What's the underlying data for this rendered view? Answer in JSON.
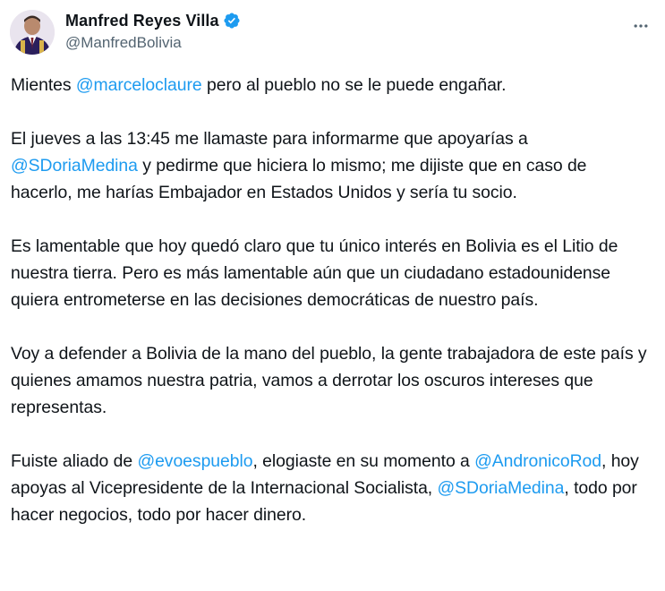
{
  "colors": {
    "accent": "#1d9bf0",
    "text": "#0f1419",
    "secondary": "#536471"
  },
  "author": {
    "display_name": "Manfred Reyes Villa",
    "handle": "@ManfredBolivia",
    "verified_icon": "verified-badge-icon",
    "avatar_icon": "profile-photo"
  },
  "menu": {
    "icon": "more-horizontal-icon"
  },
  "tweet": {
    "p1": {
      "t1": "Mientes ",
      "m1": "@marceloclaure",
      "t2": " pero al pueblo no se le puede engañar."
    },
    "p2": {
      "t1": "El jueves a las 13:45 me llamaste  para informarme que apoyarías a ",
      "m1": "@SDoriaMedina",
      "t2": " y pedirme que hiciera lo mismo; me dijiste que en caso de hacerlo, me harías Embajador en Estados Unidos y sería tu socio."
    },
    "p3": {
      "t1": "Es lamentable que hoy quedó claro que tu único interés en Bolivia es el Litio de nuestra tierra. Pero es más lamentable aún que un ciudadano estadounidense quiera entrometerse en las decisiones democráticas de nuestro país."
    },
    "p4": {
      "t1": "Voy a defender a Bolivia de la mano del pueblo, la gente trabajadora de este país y quienes amamos nuestra patria, vamos a derrotar los oscuros intereses que representas."
    },
    "p5": {
      "t1": "Fuiste aliado de ",
      "m1": "@evoespueblo",
      "t2": ", elogiaste en su momento a ",
      "m2": "@AndronicoRod",
      "t3": ", hoy apoyas al Vicepresidente de la Internacional Socialista, ",
      "m3": "@SDoriaMedina",
      "t4": ", todo por hacer negocios, todo por hacer dinero."
    }
  }
}
